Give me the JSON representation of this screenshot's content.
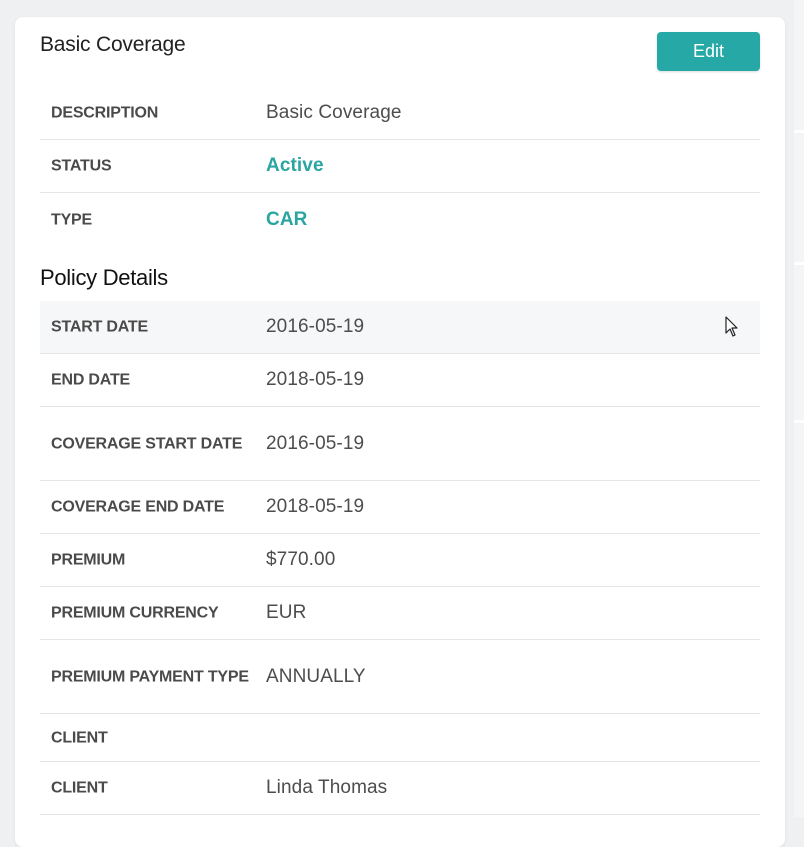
{
  "card": {
    "title": "Basic Coverage",
    "edit_label": "Edit"
  },
  "summary_rows": [
    {
      "label": "DESCRIPTION",
      "value": "Basic Coverage"
    },
    {
      "label": "STATUS",
      "value": "Active"
    },
    {
      "label": "TYPE",
      "value": "CAR"
    }
  ],
  "policy_section": {
    "title": "Policy Details"
  },
  "policy_rows": [
    {
      "label": "START DATE",
      "value": "2016-05-19"
    },
    {
      "label": "END DATE",
      "value": "2018-05-19"
    },
    {
      "label": "COVERAGE START DATE",
      "value": "2016-05-19"
    },
    {
      "label": "COVERAGE END DATE",
      "value": "2018-05-19"
    },
    {
      "label": "PREMIUM",
      "value": "$770.00"
    },
    {
      "label": "PREMIUM CURRENCY",
      "value": "EUR"
    },
    {
      "label": "PREMIUM PAYMENT TYPE",
      "value": "ANNUALLY"
    },
    {
      "label": "CLIENT",
      "value": ""
    },
    {
      "label": "CLIENT",
      "value": "Linda Thomas"
    }
  ],
  "colors": {
    "accent": "#26a9a6",
    "label_text": "#4a4a4a",
    "value_text": "#4d4d4d"
  },
  "icons": {
    "pointer": "mouse-pointer-icon"
  }
}
